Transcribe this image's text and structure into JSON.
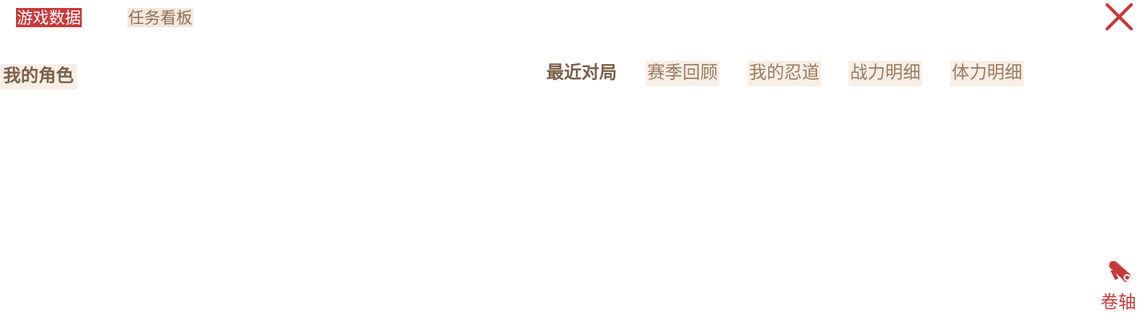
{
  "top_tabs": {
    "game_data": "游戏数据",
    "task_board": "任务看板"
  },
  "close_button": {
    "icon": "close-icon",
    "color": "#c8393b"
  },
  "section": {
    "title": "我的角色"
  },
  "sub_tabs": [
    {
      "label": "最近对局",
      "active": true
    },
    {
      "label": "赛季回顾",
      "active": false
    },
    {
      "label": "我的忍道",
      "active": false
    },
    {
      "label": "战力明细",
      "active": false
    },
    {
      "label": "体力明细",
      "active": false
    }
  ],
  "scroll_button": {
    "label": "卷轴",
    "icon": "scroll-icon"
  },
  "colors": {
    "accent": "#c8393b",
    "brown_text": "#7b6048",
    "light_brown_text": "#9d7a5e",
    "tab_bg": "#f7efe7"
  }
}
